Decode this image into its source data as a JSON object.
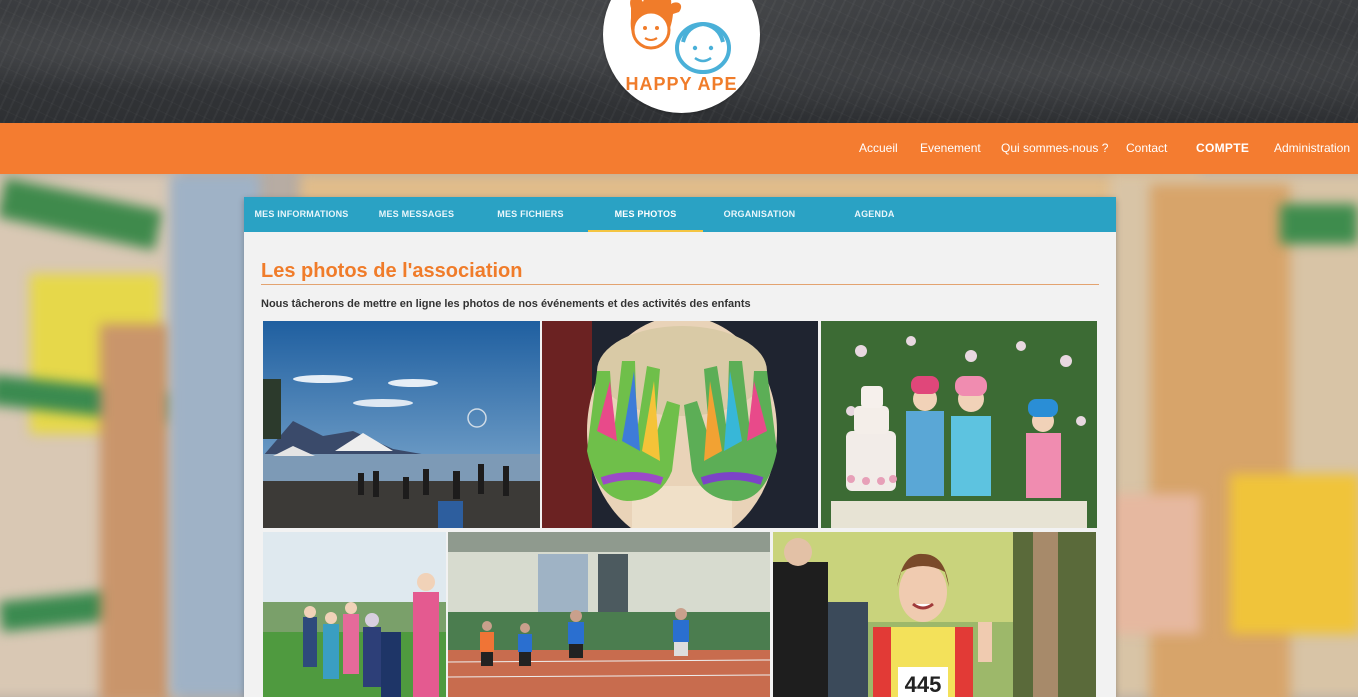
{
  "brand": {
    "logo_text": "HAPPY APE"
  },
  "nav": {
    "items": [
      {
        "label": "Accueil"
      },
      {
        "label": "Evenement"
      },
      {
        "label": "Qui sommes-nous ?"
      },
      {
        "label": "Contact"
      },
      {
        "label": "COMPTE"
      },
      {
        "label": "Administration"
      }
    ]
  },
  "tabs": [
    {
      "label": "MES INFORMATIONS"
    },
    {
      "label": "MES MESSAGES"
    },
    {
      "label": "MES FICHIERS"
    },
    {
      "label": "MES PHOTOS",
      "active": true
    },
    {
      "label": "ORGANISATION"
    },
    {
      "label": "AGENDA"
    }
  ],
  "main": {
    "title": "Les photos de l'association",
    "intro": "Nous tâcherons de mettre en ligne les photos de nos événements et des activités des enfants"
  },
  "photos": [
    {
      "name": "lakeside-event-photo"
    },
    {
      "name": "painted-hands-photo"
    },
    {
      "name": "cake-kids-photo"
    },
    {
      "name": "field-kids-photo"
    },
    {
      "name": "track-race-photo"
    },
    {
      "name": "runner-girl-photo",
      "bib": "445"
    }
  ],
  "colors": {
    "orange": "#f47c30",
    "blue": "#2aa2c4",
    "title": "#f07c2a"
  }
}
